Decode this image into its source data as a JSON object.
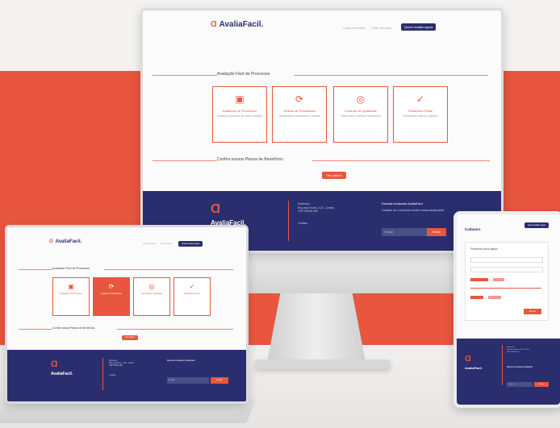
{
  "brand": {
    "name": "AvaliaFacil.",
    "mark": "Ɑ",
    "color_primary": "#2a2e6e",
    "color_accent": "#e8563f"
  },
  "nav": {
    "link1": "Como funciona",
    "link2": "Fale conosco",
    "button": "Quero avaliar agora"
  },
  "section1": {
    "title": "Avaliação Fácil de Processos"
  },
  "cards": [
    {
      "icon": "document-icon",
      "glyph": "▣",
      "title": "Avaliação de Processos",
      "desc": "Analise processos de forma simples"
    },
    {
      "icon": "refresh-icon",
      "glyph": "⟳",
      "title": "Gestão de Resultados",
      "desc": "Acompanhe indicadores e metas"
    },
    {
      "icon": "target-icon",
      "glyph": "◎",
      "title": "Controle de Qualidade",
      "desc": "Padronize e melhore resultados"
    },
    {
      "icon": "check-icon",
      "glyph": "✓",
      "title": "Relatórios Finais",
      "desc": "Resultados claros e rápidos"
    }
  ],
  "section2": {
    "title": "Confira nossos Planos de Benefícios",
    "cta": "Ver planos"
  },
  "footer": {
    "col1": "Endereço\nRua das Flores, 123 - Centro\nCEP 00000-000",
    "col1b": "Contato",
    "col2": "Receba novidades AvaliaFacil",
    "col2sub": "Cadastre seu e-mail para receber nossas atualizações",
    "input": "E-mail",
    "button": "Enviar"
  },
  "tablet": {
    "title": "Cadastro",
    "form_title": "Preencha seus dados",
    "button": "Enviar"
  }
}
